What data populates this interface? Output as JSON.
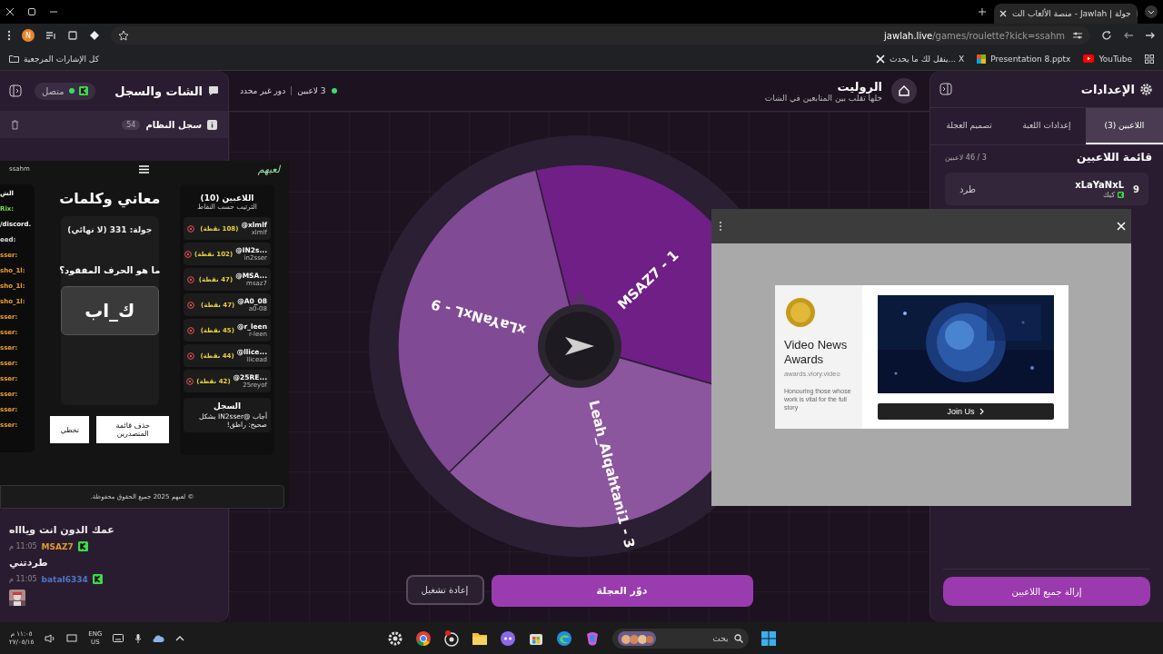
{
  "browser": {
    "tab_title": "جولة | Jawlah - منصة الألعاب الت",
    "profile_initial": "N",
    "url_host": "jawlah.live",
    "url_path": "/games/roulette?kick=ssahm",
    "all_bookmarks": "كل الإشارات المرجعية",
    "bookmarks": [
      {
        "kind": "youtube",
        "label": "YouTube"
      },
      {
        "kind": "slides",
        "label": "Presentation 8.pptx"
      },
      {
        "kind": "x",
        "label": "ينقل لك ما يحدث... X"
      }
    ]
  },
  "chat_panel": {
    "title": "الشات والسجل",
    "status": "متصل",
    "system_log": {
      "label": "سجل النظام",
      "count": "54"
    },
    "messages": [
      {
        "kind": "text",
        "text": "عمك الدون انت وياااه"
      },
      {
        "kind": "header",
        "user": "MSAZ7",
        "time": "11:05 م",
        "color": "#e09a2e"
      },
      {
        "kind": "text",
        "text": "طردتني"
      },
      {
        "kind": "header",
        "user": "bataI6334",
        "time": "11:05 م",
        "color": "#4a78c8"
      },
      {
        "kind": "picture"
      }
    ]
  },
  "roulette": {
    "title": "الروليت",
    "subtitle": "خلها تقلب بين المتابعين في الشات",
    "players": "3 لاعبين",
    "turn": "دور غير محدد",
    "segments": [
      {
        "label": "MSAZ7 - 1",
        "color": "#6f1f86"
      },
      {
        "label": "Leah_Alqahtani1 - 3",
        "color": "#8b569d"
      },
      {
        "label": "xLaYaNxL - 9",
        "color": "#814a95"
      }
    ],
    "spin_button": "دوّر العجلة",
    "restart_button": "إعادة تشغيل"
  },
  "settings": {
    "title": "الإعدادات",
    "tabs": [
      {
        "label": "اللاعبين (3)",
        "selected": true
      },
      {
        "label": "إعدادات اللعبة",
        "selected": false
      },
      {
        "label": "تصميم العجلة",
        "selected": false
      }
    ],
    "list_title": "قائمة اللاعبين",
    "count": "3 / 46 لاعبين",
    "players": [
      {
        "number": "9",
        "name": "xLaYaNxL",
        "platform": "كيك",
        "action": "طرد"
      }
    ],
    "remove_all": "إزالة جميع اللاعبين"
  },
  "game_window": {
    "brand": "لعبهم",
    "user": "ssahm",
    "title": "معاني وكلمات",
    "round": "جولة: 331 (لا نهائي)",
    "question": "ما هو الحرف المفقود؟",
    "word": "ك_اب",
    "buttons": [
      "حذف قائمة المتصدرين",
      "تخطي"
    ],
    "chat_fragments": [
      {
        "text": "الش",
        "color": "#ffffff"
      },
      {
        "text": "Rix:",
        "color": "#7ee04a"
      },
      {
        "text": "/discord.",
        "color": "#ffffff"
      },
      {
        "text": "eed:",
        "color": "#e0e0e0"
      },
      {
        "text": "sser:",
        "color": "#f0a030"
      },
      {
        "text": "sho_1l:",
        "color": "#f0a030"
      },
      {
        "text": "sho_1l:",
        "color": "#f0a030"
      },
      {
        "text": "sho_1l:",
        "color": "#f0a030"
      },
      {
        "text": "sser:",
        "color": "#f0a030"
      },
      {
        "text": "sser:",
        "color": "#f0a030"
      },
      {
        "text": "sser:",
        "color": "#f0a030"
      },
      {
        "text": "sser:",
        "color": "#f0a030"
      },
      {
        "text": "sser:",
        "color": "#f0a030"
      },
      {
        "text": "sser:",
        "color": "#f0a030"
      },
      {
        "text": "sser:",
        "color": "#f0a030"
      },
      {
        "text": "sser:",
        "color": "#f0a030"
      }
    ],
    "leaderboard": {
      "title": "اللاعبين (10)",
      "subtitle": "الترتيب حسب النقاط",
      "players": [
        {
          "name": "@xlmlf",
          "handle": "xlmlf",
          "points": "(108 نقطة)"
        },
        {
          "name": "@IN2s...",
          "handle": "in2sser",
          "points": "(102 نقطة)"
        },
        {
          "name": "@MSA...",
          "handle": "msaz7",
          "points": "(47 نقطة)"
        },
        {
          "name": "@A0_08",
          "handle": "a0-08",
          "points": "(47 نقطة)"
        },
        {
          "name": "@r_leen",
          "handle": "r-leen",
          "points": "(45 نقطة)"
        },
        {
          "name": "@llice...",
          "handle": "llicead",
          "points": "(44 نقطة)"
        },
        {
          "name": "@25RE...",
          "handle": "25reyof",
          "points": "(42 نقطة)"
        }
      ]
    },
    "log": {
      "title": "السجل",
      "entries": [
        "أجاب @IN2sser بشكل صحيح: راطق!"
      ]
    },
    "footer": "© لعبهم 2025 جميع الحقوق محفوظة."
  },
  "ad": {
    "title": "Video News Awards",
    "domain": "awards.viory.video",
    "description": "Honouring those whose work is vital for the full story",
    "button": "Join Us"
  },
  "taskbar": {
    "search": "بحث",
    "language": "ENG",
    "region": "US",
    "time": "١١:٠٥ م",
    "date": "٢٧/٠٥/١٥"
  }
}
